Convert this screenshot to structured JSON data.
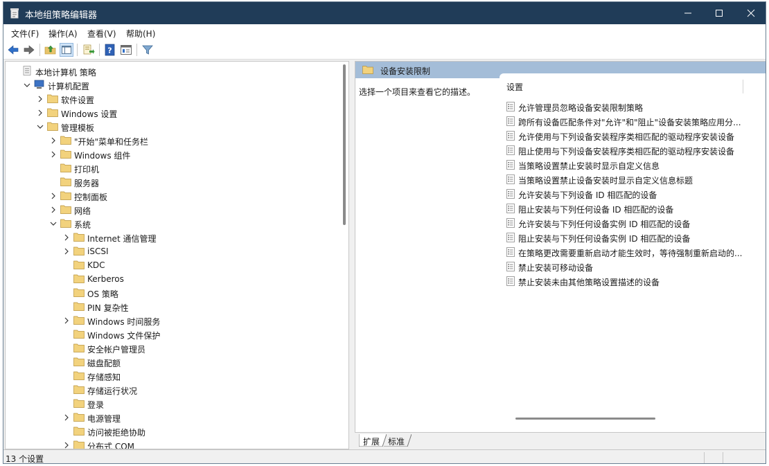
{
  "window": {
    "title": "本地组策略编辑器"
  },
  "menu": [
    "文件(F)",
    "操作(A)",
    "查看(V)",
    "帮助(H)"
  ],
  "toolbar": [
    "back-icon",
    "forward-icon",
    "up-folder-icon",
    "show-hide-tree-icon",
    "export-list-icon",
    "help-icon",
    "properties-icon",
    "filter-icon"
  ],
  "tree": [
    {
      "label": "本地计算机 策略",
      "level": 0,
      "chevron": "none",
      "icon": "policy"
    },
    {
      "label": "计算机配置",
      "level": 1,
      "chevron": "open",
      "icon": "computer"
    },
    {
      "label": "软件设置",
      "level": 2,
      "chevron": "closed",
      "icon": "folder"
    },
    {
      "label": "Windows 设置",
      "level": 2,
      "chevron": "closed",
      "icon": "folder"
    },
    {
      "label": "管理模板",
      "level": 2,
      "chevron": "open",
      "icon": "folder"
    },
    {
      "label": "\"开始\"菜单和任务栏",
      "level": 3,
      "chevron": "closed",
      "icon": "folder"
    },
    {
      "label": "Windows 组件",
      "level": 3,
      "chevron": "closed",
      "icon": "folder"
    },
    {
      "label": "打印机",
      "level": 3,
      "chevron": "none",
      "icon": "folder"
    },
    {
      "label": "服务器",
      "level": 3,
      "chevron": "none",
      "icon": "folder"
    },
    {
      "label": "控制面板",
      "level": 3,
      "chevron": "closed",
      "icon": "folder"
    },
    {
      "label": "网络",
      "level": 3,
      "chevron": "closed",
      "icon": "folder"
    },
    {
      "label": "系统",
      "level": 3,
      "chevron": "open",
      "icon": "folder"
    },
    {
      "label": "Internet 通信管理",
      "level": 4,
      "chevron": "closed",
      "icon": "folder"
    },
    {
      "label": "iSCSI",
      "level": 4,
      "chevron": "closed",
      "icon": "folder"
    },
    {
      "label": "KDC",
      "level": 4,
      "chevron": "none",
      "icon": "folder"
    },
    {
      "label": "Kerberos",
      "level": 4,
      "chevron": "none",
      "icon": "folder"
    },
    {
      "label": "OS 策略",
      "level": 4,
      "chevron": "none",
      "icon": "folder"
    },
    {
      "label": "PIN 复杂性",
      "level": 4,
      "chevron": "none",
      "icon": "folder"
    },
    {
      "label": "Windows 时间服务",
      "level": 4,
      "chevron": "closed",
      "icon": "folder"
    },
    {
      "label": "Windows 文件保护",
      "level": 4,
      "chevron": "none",
      "icon": "folder"
    },
    {
      "label": "安全帐户管理员",
      "level": 4,
      "chevron": "none",
      "icon": "folder"
    },
    {
      "label": "磁盘配额",
      "level": 4,
      "chevron": "none",
      "icon": "folder"
    },
    {
      "label": "存储感知",
      "level": 4,
      "chevron": "none",
      "icon": "folder"
    },
    {
      "label": "存储运行状况",
      "level": 4,
      "chevron": "none",
      "icon": "folder"
    },
    {
      "label": "登录",
      "level": 4,
      "chevron": "none",
      "icon": "folder"
    },
    {
      "label": "电源管理",
      "level": 4,
      "chevron": "closed",
      "icon": "folder"
    },
    {
      "label": "访问被拒绝协助",
      "level": 4,
      "chevron": "none",
      "icon": "folder"
    },
    {
      "label": "分布式 COM",
      "level": 4,
      "chevron": "closed",
      "icon": "folder"
    }
  ],
  "right_pane": {
    "title": "设备安装限制",
    "description": "选择一个项目来查看它的描述。",
    "column_header": "设置",
    "policies": [
      "允许管理员忽略设备安装限制策略",
      "跨所有设备匹配条件对\"允许\"和\"阻止\"设备安装策略应用分...",
      "允许使用与下列设备安装程序类相匹配的驱动程序安装设备",
      "阻止使用与下列设备安装程序类相匹配的驱动程序安装设备",
      "当策略设置禁止安装时显示自定义信息",
      "当策略设置禁止设备安装时显示自定义信息标题",
      "允许安装与下列设备 ID 相匹配的设备",
      "阻止安装与下列任何设备 ID 相匹配的设备",
      "允许安装与下列任何设备实例 ID 相匹配的设备",
      "阻止安装与下列任何设备实例 ID 相匹配的设备",
      "在策略更改需要重新启动才能生效时，等待强制重新启动的...",
      "禁止安装可移动设备",
      "禁止安装未由其他策略设置描述的设备"
    ]
  },
  "tabs": [
    "扩展",
    "标准"
  ],
  "status": {
    "text": "13 个设置"
  },
  "colors": {
    "titlebar": "#203c58",
    "right_header": "#a4bdd8",
    "folder": "#e8c46a",
    "accent_blue": "#2f6fc8"
  }
}
